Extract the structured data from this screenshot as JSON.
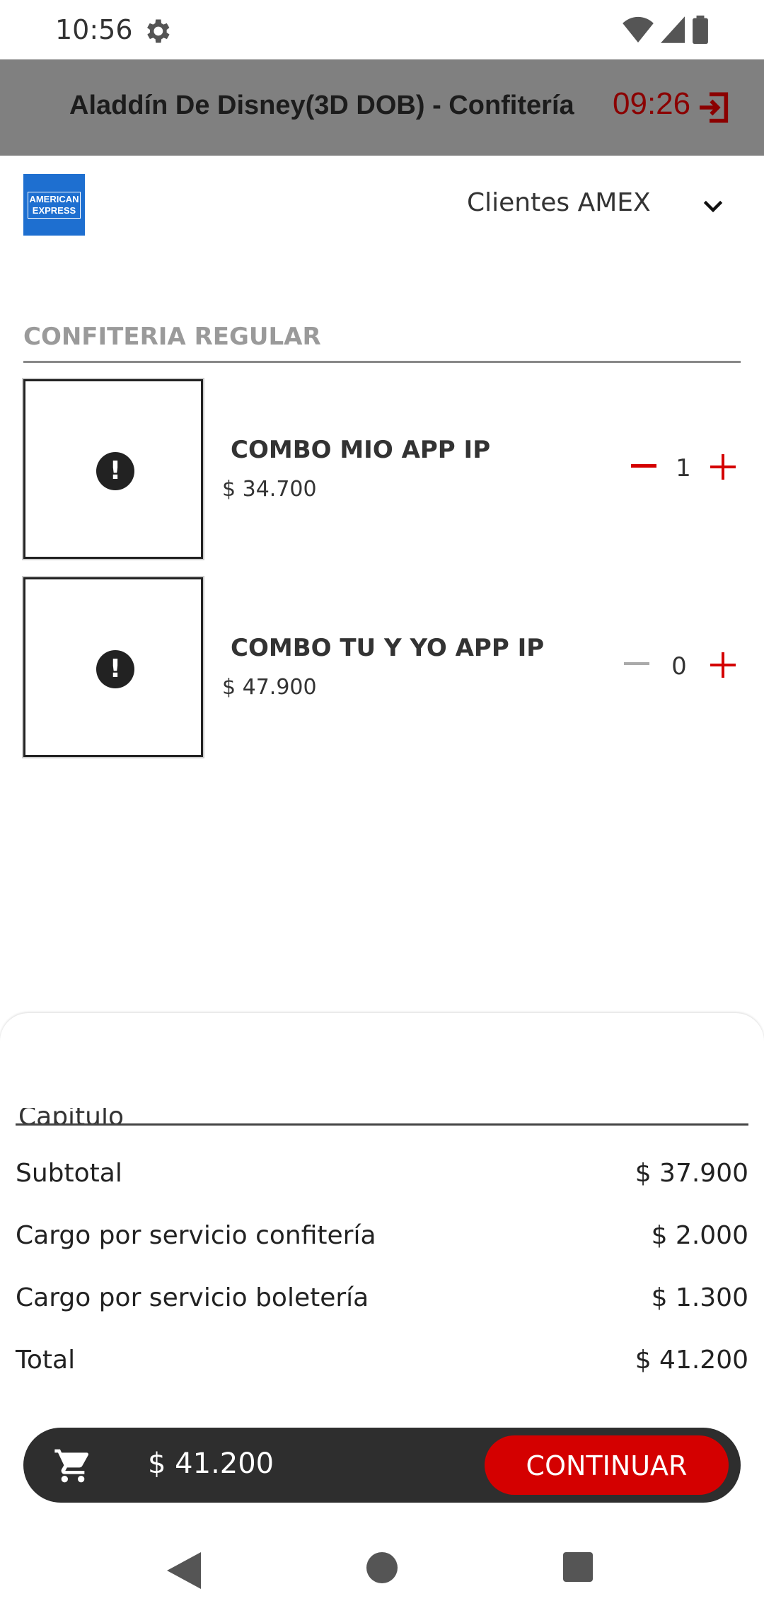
{
  "status_bar": {
    "time": "10:56",
    "icons": [
      "gear-icon",
      "wifi-icon",
      "signal-icon",
      "battery-icon"
    ]
  },
  "header": {
    "title": "Aladdín De Disney(3D DOB) - Confitería",
    "timer": "09:26",
    "exit_icon": "exit-icon",
    "background": "#808080",
    "timer_color": "#8b0000"
  },
  "payment": {
    "logo_text": [
      "AMERICAN",
      "EXPRESS"
    ],
    "selected_client": "Clientes AMEX"
  },
  "section": {
    "title": "CONFITERIA REGULAR"
  },
  "products": [
    {
      "name": "COMBO MIO APP IP",
      "price": "$ 34.700",
      "quantity": "1",
      "minus_active": true
    },
    {
      "name": "COMBO TU Y YO APP IP",
      "price": "$ 47.900",
      "quantity": "0",
      "minus_active": false
    }
  ],
  "summary": {
    "cutoff_label": "Capitulo",
    "rows": [
      {
        "label": "Subtotal",
        "value": "$ 37.900"
      },
      {
        "label": "Cargo por servicio confitería",
        "value": "$ 2.000"
      },
      {
        "label": "Cargo por servicio boletería",
        "value": "$ 1.300"
      },
      {
        "label": "Total",
        "value": "$ 41.200"
      }
    ]
  },
  "action_bar": {
    "total": "$ 41.200",
    "continue_label": "CONTINUAR",
    "accent": "#d40000"
  }
}
